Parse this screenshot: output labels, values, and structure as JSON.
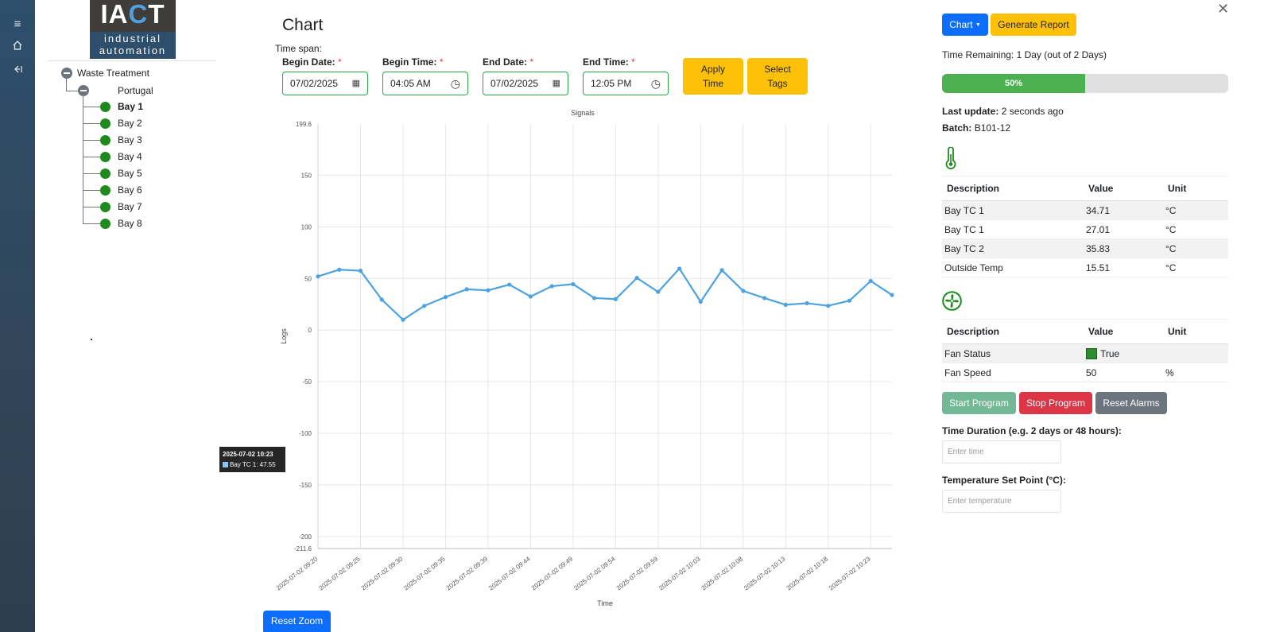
{
  "sidebar": {
    "menu_icon": "menu-icon",
    "home_icon": "home-icon",
    "collapse_icon": "collapse-icon"
  },
  "logo": {
    "line1": "industrial",
    "line2": "automation"
  },
  "tree": {
    "root": "Waste Treatment",
    "site": "Portugal",
    "bays": [
      "Bay 1",
      "Bay 2",
      "Bay 3",
      "Bay 4",
      "Bay 5",
      "Bay 6",
      "Bay 7",
      "Bay 8"
    ],
    "bay_status_color": "#1e8a1e"
  },
  "header": {
    "title": "Chart",
    "time_span_label": "Time span:",
    "begin_date_label": "Begin Date:",
    "begin_time_label": "Begin Time:",
    "end_date_label": "End Date:",
    "end_time_label": "End Time:",
    "required_mark": "*",
    "begin_date": "07/02/2025",
    "begin_time": "04:05 AM",
    "end_date": "07/02/2025",
    "end_time": "12:05 PM",
    "apply_line1": "Apply",
    "apply_line2": "Time",
    "select_line1": "Select",
    "select_line2": "Tags"
  },
  "chart_data": {
    "type": "line",
    "title": "Signals",
    "xlabel": "Time",
    "ylabel": "Logs",
    "ylim": [
      -211.6,
      199.6
    ],
    "yticks": [
      {
        "v": 199.6,
        "label": "199.6"
      },
      {
        "v": 150,
        "label": "150"
      },
      {
        "v": 100,
        "label": "100"
      },
      {
        "v": 50,
        "label": "50"
      },
      {
        "v": 0,
        "label": "0"
      },
      {
        "v": -50,
        "label": "-50"
      },
      {
        "v": -100,
        "label": "-100"
      },
      {
        "v": -150,
        "label": "-150"
      },
      {
        "v": -200,
        "label": "-200"
      },
      {
        "v": -211.6,
        "label": "-211.6"
      }
    ],
    "xrange": [
      0,
      27
    ],
    "xticks": [
      {
        "v": 0,
        "label": "2025-07-02 09:20"
      },
      {
        "v": 2,
        "label": "2025-07-02 09:25"
      },
      {
        "v": 4,
        "label": "2025-07-02 09:30"
      },
      {
        "v": 6,
        "label": "2025-07-02 09:35"
      },
      {
        "v": 8,
        "label": "2025-07-02 09:39"
      },
      {
        "v": 10,
        "label": "2025-07-02 09:44"
      },
      {
        "v": 12,
        "label": "2025-07-02 09:49"
      },
      {
        "v": 14,
        "label": "2025-07-02 09:54"
      },
      {
        "v": 16,
        "label": "2025-07-02 09:59"
      },
      {
        "v": 18,
        "label": "2025-07-02 10:03"
      },
      {
        "v": 20,
        "label": "2025-07-02 10:08"
      },
      {
        "v": 22,
        "label": "2025-07-02 10:13"
      },
      {
        "v": 24,
        "label": "2025-07-02 10:18"
      },
      {
        "v": 26,
        "label": "2025-07-02 10:23"
      }
    ],
    "series": [
      {
        "name": "Bay TC 1",
        "color": "#4da3e0",
        "values": [
          52,
          58.5,
          57.5,
          29.5,
          10,
          23.5,
          32,
          39.5,
          38.5,
          44,
          32.5,
          42.5,
          44.5,
          31,
          30,
          50.5,
          37,
          59.5,
          27.5,
          58,
          38,
          31,
          24.5,
          26,
          23.5,
          28.5,
          47.55,
          34
        ]
      }
    ],
    "grid": true,
    "tooltip": {
      "title": "2025-07-02 10:23",
      "series": "Bay TC 1",
      "value": "47.55",
      "text": "Bay TC 1: 47.55"
    }
  },
  "reset_zoom_label": "Reset Zoom",
  "right": {
    "chart_button": "Chart",
    "report_button": "Generate Report",
    "time_remaining": "Time Remaining: 1 Day (out of 2 Days)",
    "progress_value": 0.5,
    "progress_label": "50%",
    "last_update_label": "Last update:",
    "last_update_value": "2 seconds ago",
    "batch_label": "Batch:",
    "batch_value": "B101-12",
    "temp_table": {
      "icon": "thermometer-icon",
      "headers": [
        "Description",
        "Value",
        "Unit"
      ],
      "rows": [
        [
          "Bay TC 1",
          "34.71",
          "°C"
        ],
        [
          "Bay TC 1",
          "27.01",
          "°C"
        ],
        [
          "Bay TC 2",
          "35.83",
          "°C"
        ],
        [
          "Outside Temp",
          "15.51",
          "°C"
        ]
      ]
    },
    "fan_table": {
      "icon": "fan-icon",
      "headers": [
        "Description",
        "Value",
        "Unit"
      ],
      "rows": [
        [
          "Fan Status",
          "True",
          ""
        ],
        [
          "Fan Speed",
          "50",
          "%"
        ]
      ],
      "status_color": "#2e8b2e"
    },
    "buttons": {
      "start": "Start Program",
      "stop": "Stop Program",
      "reset": "Reset Alarms"
    },
    "duration_label": "Time Duration (e.g. 2 days or 48 hours):",
    "duration_placeholder": "Enter time",
    "setpoint_label": "Temperature Set Point (°C):",
    "setpoint_placeholder": "Enter temperature",
    "close_icon": "close-icon"
  }
}
